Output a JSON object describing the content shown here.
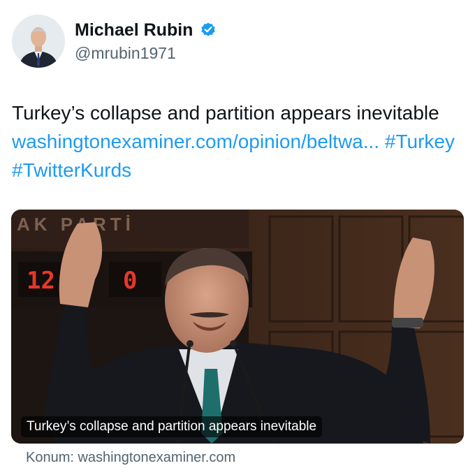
{
  "author": {
    "name": "Michael Rubin",
    "handle": "@mrubin1971",
    "verified": true,
    "verified_color": "#1d9bf0",
    "avatar_icon": "profile-photo-man-in-suit"
  },
  "tweet": {
    "text": "Turkey’s collapse and partition appears inevitable",
    "link_text": "washingtonexaminer.com/opinion/beltwa...",
    "hashtags": [
      "#Turkey",
      "#TwitterKurds"
    ],
    "link_color": "#1d9bf0"
  },
  "card": {
    "image_icon": "photo-speaker-raising-arms-at-podium",
    "backdrop_sign": "AK PARTİ",
    "counter_left": "12",
    "counter_right": "0",
    "caption": "Turkey’s collapse and partition appears inevitable",
    "source": "Konum: washingtonexaminer.com"
  },
  "colors": {
    "text_primary": "#0f1419",
    "text_secondary": "#536471",
    "accent": "#1d9bf0"
  }
}
